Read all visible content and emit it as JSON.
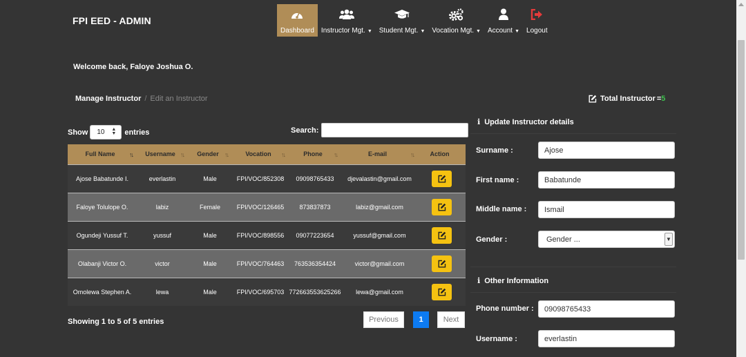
{
  "header": {
    "brand": "FPI EED - ADMIN",
    "nav": [
      {
        "label": "Dashboard",
        "icon": "dashboard-gauge-icon",
        "active": true
      },
      {
        "label": "Instructor Mgt.",
        "icon": "users-icon",
        "caret": "▼"
      },
      {
        "label": "Student Mgt.",
        "icon": "graduation-cap-icon",
        "caret": "▼"
      },
      {
        "label": "Vocation Mgt.",
        "icon": "cogs-icon",
        "caret": "▼"
      },
      {
        "label": "Account",
        "icon": "user-icon",
        "caret": "▼"
      },
      {
        "label": "Logout",
        "icon": "sign-out-icon"
      }
    ]
  },
  "welcome": "Welcome back, Faloye Joshua O.",
  "breadcrumb": {
    "current": "Manage Instructor",
    "separator": "/",
    "sub": "Edit an Instructor"
  },
  "total": {
    "label": "Total Instructor",
    "eq": "=",
    "value": "5"
  },
  "table_controls": {
    "show_label": "Show",
    "page_size": "10",
    "entries_label": "entries",
    "search_label": "Search:"
  },
  "table": {
    "columns": [
      "Full Name",
      "Username",
      "Gender",
      "Vocation",
      "Phone",
      "E-mail",
      "Action"
    ],
    "rows": [
      {
        "full_name": "Ajose Babatunde I.",
        "username": "everlastin",
        "gender": "Male",
        "vocation": "FPI/VOC/852308",
        "phone": "09098765433",
        "email": "djevalastin@gmail.com"
      },
      {
        "full_name": "Faloye Tolulope O.",
        "username": "labiz",
        "gender": "Female",
        "vocation": "FPI/VOC/126465",
        "phone": "873837873",
        "email": "labiz@gmail.com"
      },
      {
        "full_name": "Ogundeji Yussuf T.",
        "username": "yussuf",
        "gender": "Male",
        "vocation": "FPI/VOC/898556",
        "phone": "09077223654",
        "email": "yussuf@gmail.com"
      },
      {
        "full_name": "Olabanji Victor O.",
        "username": "victor",
        "gender": "Male",
        "vocation": "FPI/VOC/764463",
        "phone": "763536354424",
        "email": "victor@gmail.com"
      },
      {
        "full_name": "Omolewa Stephen A.",
        "username": "lewa",
        "gender": "Male",
        "vocation": "FPI/VOC/695703",
        "phone": "772663553625266",
        "email": "lewa@gmail.com"
      }
    ]
  },
  "showing": "Showing 1 to 5 of 5 entries",
  "pagination": {
    "previous": "Previous",
    "current": "1",
    "next": "Next"
  },
  "form": {
    "update_title": "Update Instructor details",
    "other_title": "Other Information",
    "surname": {
      "label": "Surname :",
      "value": "Ajose"
    },
    "first_name": {
      "label": "First name :",
      "value": "Babatunde"
    },
    "middle_name": {
      "label": "Middle name :",
      "value": "Ismail"
    },
    "gender": {
      "label": "Gender :",
      "value": "Gender ..."
    },
    "phone": {
      "label": "Phone number :",
      "value": "09098765433"
    },
    "username": {
      "label": "Username :",
      "value": "everlastin"
    }
  },
  "colors": {
    "background": "#343434",
    "accent": "#b08d57",
    "action": "#f5c211",
    "page_active": "#0d7bf2",
    "count": "#3fbf4f",
    "logout_icon": "#e23b3b"
  }
}
